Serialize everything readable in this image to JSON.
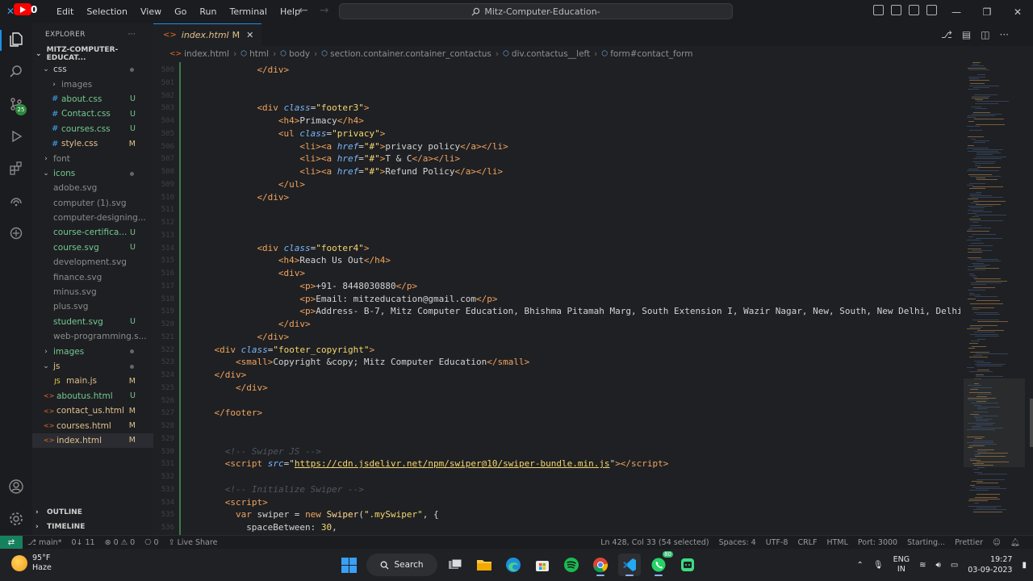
{
  "titlebar": {
    "menu": [
      "Edit",
      "Selection",
      "View",
      "Go",
      "Run",
      "Terminal",
      "Help"
    ],
    "command_center": "Mitz-Computer-Education-",
    "yt_badge": "0"
  },
  "activity": {
    "scm_badge": "25"
  },
  "sidebar": {
    "title": "EXPLORER",
    "more": "···",
    "root": "MITZ-COMPUTER-EDUCAT...",
    "items": [
      {
        "name": "css",
        "kind": "folder-open",
        "depth": 1,
        "status": "dot",
        "color": "c-normal"
      },
      {
        "name": "images",
        "kind": "folder-closed",
        "depth": 2,
        "status": "",
        "color": "c-faded"
      },
      {
        "name": "about.css",
        "kind": "css",
        "depth": 2,
        "status": "U",
        "color": "c-untracked"
      },
      {
        "name": "Contact.css",
        "kind": "css",
        "depth": 2,
        "status": "U",
        "color": "c-untracked"
      },
      {
        "name": "courses.css",
        "kind": "css",
        "depth": 2,
        "status": "U",
        "color": "c-untracked"
      },
      {
        "name": "style.css",
        "kind": "css",
        "depth": 2,
        "status": "M",
        "color": "c-modified"
      },
      {
        "name": "font",
        "kind": "folder-closed",
        "depth": 1,
        "status": "",
        "color": "c-faded"
      },
      {
        "name": "icons",
        "kind": "folder-open",
        "depth": 1,
        "status": "dot",
        "color": "c-untracked"
      },
      {
        "name": "adobe.svg",
        "kind": "svg",
        "depth": 2,
        "status": "",
        "color": "c-faded"
      },
      {
        "name": "computer (1).svg",
        "kind": "svg",
        "depth": 2,
        "status": "",
        "color": "c-faded"
      },
      {
        "name": "computer-designing...",
        "kind": "svg",
        "depth": 2,
        "status": "",
        "color": "c-faded"
      },
      {
        "name": "course-certifica...",
        "kind": "svg",
        "depth": 2,
        "status": "U",
        "color": "c-untracked"
      },
      {
        "name": "course.svg",
        "kind": "svg",
        "depth": 2,
        "status": "U",
        "color": "c-untracked"
      },
      {
        "name": "development.svg",
        "kind": "svg",
        "depth": 2,
        "status": "",
        "color": "c-faded"
      },
      {
        "name": "finance.svg",
        "kind": "svg",
        "depth": 2,
        "status": "",
        "color": "c-faded"
      },
      {
        "name": "minus.svg",
        "kind": "svg",
        "depth": 2,
        "status": "",
        "color": "c-faded"
      },
      {
        "name": "plus.svg",
        "kind": "svg",
        "depth": 2,
        "status": "",
        "color": "c-faded"
      },
      {
        "name": "student.svg",
        "kind": "svg",
        "depth": 2,
        "status": "U",
        "color": "c-untracked"
      },
      {
        "name": "web-programming.s...",
        "kind": "svg",
        "depth": 2,
        "status": "",
        "color": "c-faded"
      },
      {
        "name": "images",
        "kind": "folder-closed",
        "depth": 1,
        "status": "dot",
        "color": "c-untracked"
      },
      {
        "name": "js",
        "kind": "folder-open",
        "depth": 1,
        "status": "dot",
        "color": "c-modified"
      },
      {
        "name": "main.js",
        "kind": "js",
        "depth": 2,
        "status": "M",
        "color": "c-modified"
      },
      {
        "name": "aboutus.html",
        "kind": "html",
        "depth": 1,
        "status": "U",
        "color": "c-untracked"
      },
      {
        "name": "contact_us.html",
        "kind": "html",
        "depth": 1,
        "status": "M",
        "color": "c-modified"
      },
      {
        "name": "courses.html",
        "kind": "html",
        "depth": 1,
        "status": "M",
        "color": "c-modified"
      },
      {
        "name": "index.html",
        "kind": "html",
        "depth": 1,
        "status": "M",
        "color": "c-modified",
        "active": true
      }
    ],
    "outline": "OUTLINE",
    "timeline": "TIMELINE"
  },
  "editor": {
    "tab_label": "index.html",
    "tab_status": "M",
    "breadcrumb": [
      "index.html",
      "html",
      "body",
      "section.container.container_contactus",
      "div.contactus__left",
      "form#contact_form"
    ],
    "code_lines": [
      {
        "n": "500",
        "i": 6,
        "html": "<span class='tag'>&lt;/div&gt;</span>"
      },
      {
        "n": "501",
        "i": 0,
        "html": ""
      },
      {
        "n": "502",
        "i": 0,
        "html": ""
      },
      {
        "n": "503",
        "i": 6,
        "html": "<span class='tag'>&lt;div</span> <span class='attr'>class</span><span class='txt'>=</span><span class='str'>\"footer3\"</span><span class='tag'>&gt;</span>"
      },
      {
        "n": "504",
        "i": 8,
        "html": "<span class='tag'>&lt;h4&gt;</span><span class='txt'>Primacy</span><span class='tag'>&lt;/h4&gt;</span>"
      },
      {
        "n": "505",
        "i": 8,
        "html": "<span class='tag'>&lt;ul</span> <span class='attr'>class</span><span class='txt'>=</span><span class='str'>\"privacy\"</span><span class='tag'>&gt;</span>"
      },
      {
        "n": "506",
        "i": 10,
        "html": "<span class='tag'>&lt;li&gt;&lt;a</span> <span class='attr'>href</span><span class='txt'>=</span><span class='str'>\"#\"</span><span class='tag'>&gt;</span><span class='txt'>privacy policy</span><span class='tag'>&lt;/a&gt;&lt;/li&gt;</span>"
      },
      {
        "n": "507",
        "i": 10,
        "html": "<span class='tag'>&lt;li&gt;&lt;a</span> <span class='attr'>href</span><span class='txt'>=</span><span class='str'>\"#\"</span><span class='tag'>&gt;</span><span class='txt'>T &amp; C</span><span class='tag'>&lt;/a&gt;&lt;/li&gt;</span>"
      },
      {
        "n": "508",
        "i": 10,
        "html": "<span class='tag'>&lt;li&gt;&lt;a</span> <span class='attr'>href</span><span class='txt'>=</span><span class='str'>\"#\"</span><span class='tag'>&gt;</span><span class='txt'>Refund Policy</span><span class='tag'>&lt;/a&gt;&lt;/li&gt;</span>"
      },
      {
        "n": "509",
        "i": 8,
        "html": "<span class='tag'>&lt;/ul&gt;</span>"
      },
      {
        "n": "510",
        "i": 6,
        "html": "<span class='tag'>&lt;/div&gt;</span>"
      },
      {
        "n": "511",
        "i": 0,
        "html": ""
      },
      {
        "n": "512",
        "i": 0,
        "html": ""
      },
      {
        "n": "513",
        "i": 0,
        "html": ""
      },
      {
        "n": "514",
        "i": 6,
        "html": "<span class='tag'>&lt;div</span> <span class='attr'>class</span><span class='txt'>=</span><span class='str'>\"footer4\"</span><span class='tag'>&gt;</span>"
      },
      {
        "n": "515",
        "i": 8,
        "html": "<span class='tag'>&lt;h4&gt;</span><span class='txt'>Reach Us Out</span><span class='tag'>&lt;/h4&gt;</span>"
      },
      {
        "n": "516",
        "i": 8,
        "html": "<span class='tag'>&lt;div&gt;</span>"
      },
      {
        "n": "517",
        "i": 10,
        "html": "<span class='tag'>&lt;p&gt;</span><span class='txt'>+91- 8448030880</span><span class='tag'>&lt;/p&gt;</span>"
      },
      {
        "n": "518",
        "i": 10,
        "html": "<span class='tag'>&lt;p&gt;</span><span class='txt'>Email: mitzeducation@gmail.com</span><span class='tag'>&lt;/p&gt;</span>"
      },
      {
        "n": "519",
        "i": 10,
        "html": "<span class='tag'>&lt;p&gt;</span><span class='txt'>Address- B-7, Mitz Computer Education, Bhishma Pitamah Marg, South Extension I, Wazir Nagar, New, South, New Delhi, Delhi </span><span class='tag'>&lt;/p&gt;</span>"
      },
      {
        "n": "520",
        "i": 8,
        "html": "<span class='tag'>&lt;/div&gt;</span>"
      },
      {
        "n": "521",
        "i": 6,
        "html": "<span class='tag'>&lt;/div&gt;</span>"
      },
      {
        "n": "522",
        "i": 2,
        "html": "<span class='tag'>&lt;div</span> <span class='attr'>class</span><span class='txt'>=</span><span class='str'>\"footer_copyright\"</span><span class='tag'>&gt;</span>"
      },
      {
        "n": "523",
        "i": 4,
        "html": "<span class='tag'>&lt;small&gt;</span><span class='txt'>Copyright &amp;copy; Mitz Computer Education</span><span class='tag'>&lt;/small&gt;</span>"
      },
      {
        "n": "524",
        "i": 2,
        "html": "<span class='tag'>&lt;/div&gt;</span>"
      },
      {
        "n": "525",
        "i": 4,
        "html": "<span class='tag'>&lt;/div&gt;</span>"
      },
      {
        "n": "526",
        "i": 0,
        "html": ""
      },
      {
        "n": "527",
        "i": 2,
        "html": "<span class='tag'>&lt;/footer&gt;</span>"
      },
      {
        "n": "528",
        "i": 0,
        "html": ""
      },
      {
        "n": "529",
        "i": 0,
        "html": ""
      },
      {
        "n": "530",
        "i": 3,
        "html": "<span class='cmt'>&lt;!-- Swiper JS --&gt;</span>"
      },
      {
        "n": "531",
        "i": 3,
        "html": "<span class='tag'>&lt;script</span> <span class='attr'>src</span><span class='txt'>=</span><span class='txt'>\"</span><span class='url'>https://cdn.jsdelivr.net/npm/swiper@10/swiper-bundle.min.js</span><span class='txt'>\"</span><span class='tag'>&gt;&lt;/script&gt;</span>"
      },
      {
        "n": "532",
        "i": 0,
        "html": ""
      },
      {
        "n": "533",
        "i": 3,
        "html": "<span class='cmt'>&lt;!-- Initialize Swiper --&gt;</span>"
      },
      {
        "n": "534",
        "i": 3,
        "html": "<span class='tag'>&lt;script&gt;</span>"
      },
      {
        "n": "535",
        "i": 4,
        "html": "<span class='kw'>var</span> <span class='txt'>swiper = </span><span class='kw'>new</span> <span class='fn'>Swiper</span><span class='txt'>(</span><span class='str'>\".mySwiper\"</span><span class='txt'>, {</span>"
      },
      {
        "n": "536",
        "i": 5,
        "html": "<span class='txt'>spaceBetween: </span><span class='str'>30</span><span class='txt'>,</span>"
      }
    ]
  },
  "statusbar": {
    "branch": "main*",
    "sync": "0↓ 11",
    "problems": "⊗ 0  ⚠ 0",
    "ports": "0",
    "liveshare": "Live Share",
    "position": "Ln 428, Col 33 (54 selected)",
    "spaces": "Spaces: 4",
    "encoding": "UTF-8",
    "eol": "CRLF",
    "lang": "HTML",
    "port": "Port: 3000",
    "starting": "Starting...",
    "prettier": "Prettier"
  },
  "taskbar": {
    "temp": "95°F",
    "weather": "Haze",
    "search": "Search",
    "whatsapp_badge": "80",
    "lang_top": "ENG",
    "lang_bottom": "IN",
    "time": "19:27",
    "date": "03-09-2023"
  },
  "colors": {
    "accent": "#1d8ee6",
    "untracked": "#73c991",
    "modified": "#e2c08d",
    "remote": "#16825d"
  }
}
